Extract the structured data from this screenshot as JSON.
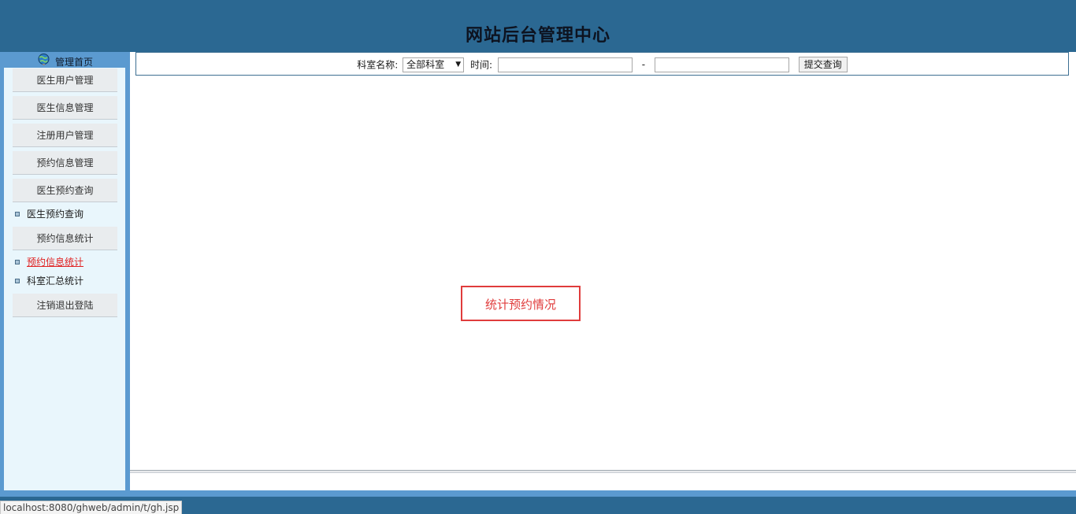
{
  "header": {
    "title": "网站后台管理中心"
  },
  "sidebar": {
    "home_label": "管理首页",
    "buttons": [
      "医生用户管理",
      "医生信息管理",
      "注册用户管理",
      "预约信息管理",
      "医生预约查询",
      "预约信息统计",
      "注销退出登陆"
    ],
    "links": {
      "doctor_query": "医生预约查询",
      "appointment_stats": "预约信息统计",
      "dept_summary": "科室汇总统计"
    }
  },
  "filter": {
    "dept_label": "科室名称:",
    "dept_value": "全部科室",
    "time_label": "时间:",
    "date_from": "",
    "date_to": "",
    "dash": "-",
    "submit_label": "提交查询"
  },
  "main": {
    "stat_label": "统计预约情况"
  },
  "status_bar": {
    "url": "localhost:8080/ghweb/admin/t/gh.jsp"
  },
  "colors": {
    "header_bg": "#2b6892",
    "frame_bg": "#5b9ad0",
    "sidebar_bg": "#e9f6fc",
    "accent_red": "#e03c3c"
  }
}
